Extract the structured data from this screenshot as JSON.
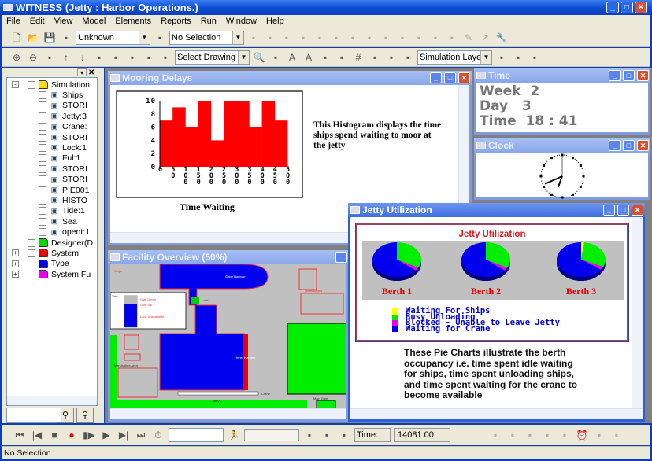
{
  "app": {
    "title": "WITNESS (Jetty : Harbor Operations.)"
  },
  "menu": [
    "File",
    "Edit",
    "View",
    "Model",
    "Elements",
    "Reports",
    "Run",
    "Window",
    "Help"
  ],
  "toolbar1": {
    "icons_left": [
      "new-icon",
      "open-icon",
      "save-icon"
    ],
    "type_combo": "Unknown",
    "selection_combo": "No Selection",
    "icons_right": [
      "walk-icon",
      "run-icon",
      "push-icon",
      "paint-icon",
      "flask-icon",
      "picture-icon",
      "link-icon",
      "move-icon",
      "gears-icon",
      "blob-icon",
      "image-icon",
      "camera-icon",
      "chart-icon",
      "pencil-icon",
      "arrow-icon",
      "wrench-icon"
    ]
  },
  "toolbar2": {
    "icons_left": [
      "zoom-in-icon",
      "zoom-out-icon",
      "fit-icon",
      "up-icon",
      "down-icon",
      "layer-icon",
      "align-icon",
      "distribute-icon",
      "list-icon",
      "drawing-icon"
    ],
    "drawing_combo": "Select Drawing",
    "icons_mid": [
      "search-icon",
      "image-icon",
      "font-icon",
      "font-color-icon",
      "line-color-icon",
      "fill-color-icon",
      "grid-icon",
      "grid-fine-icon",
      "grid-snap-icon",
      "frame-icon"
    ],
    "layer_combo": "Simulation Laye",
    "icons_right": [
      "window-icon",
      "window-front-icon",
      "layout-icon"
    ]
  },
  "tree": {
    "items": [
      {
        "label": "Simulation",
        "icon": "folder-icon",
        "color": "#ffe000",
        "level": 0,
        "expander": "-"
      },
      {
        "label": "Ships",
        "icon": "ship-icon",
        "level": 1
      },
      {
        "label": "STORI",
        "icon": "variable-icon",
        "level": 1
      },
      {
        "label": "Jetty:3",
        "icon": "machine-icon",
        "level": 1
      },
      {
        "label": "Crane:",
        "icon": "labor-icon",
        "level": 1
      },
      {
        "label": "STORI",
        "icon": "variable-icon",
        "level": 1
      },
      {
        "label": "Lock:1",
        "icon": "machine-icon",
        "level": 1
      },
      {
        "label": "Ful:1",
        "icon": "buffer-icon",
        "level": 1
      },
      {
        "label": "STORI",
        "icon": "variable-icon",
        "level": 1
      },
      {
        "label": "STORI",
        "icon": "variable-icon",
        "level": 1
      },
      {
        "label": "PIE001",
        "icon": "pie-icon",
        "level": 1
      },
      {
        "label": "HISTO",
        "icon": "histogram-icon",
        "level": 1
      },
      {
        "label": "Tide:1",
        "icon": "timeseries-icon",
        "level": 1
      },
      {
        "label": "Sea",
        "icon": "drop-icon",
        "level": 1
      },
      {
        "label": "opent:1",
        "icon": "counter-icon",
        "level": 1
      },
      {
        "label": "Designer(D",
        "icon": "folder-icon",
        "color": "#00dd00",
        "level": 0
      },
      {
        "label": "System",
        "icon": "folder-icon",
        "color": "#ee0000",
        "level": 0,
        "expander": "+"
      },
      {
        "label": "Type",
        "icon": "folder-icon",
        "color": "#0000ee",
        "level": 0,
        "expander": "+"
      },
      {
        "label": "System Fu",
        "icon": "folder-icon",
        "color": "#ee00ee",
        "level": 0,
        "expander": "+"
      }
    ]
  },
  "windows": {
    "mooring": {
      "title": "Mooring Delays",
      "description": "This Histogram displays the time ships spend waiting to moor at the jetty"
    },
    "time": {
      "title": "Time",
      "week_label": "Week",
      "week": "2",
      "day_label": "Day",
      "day": "3",
      "time_label": "Time",
      "time": "18 : 41"
    },
    "clock": {
      "title": "Clock",
      "hour": 18,
      "minute": 41
    },
    "facility": {
      "title": "Facility Overview (50%)",
      "labels": {
        "ships": "Ships",
        "outer": "Outer Harbour",
        "lock": "Lock",
        "tide": "Tide",
        "safe": "Safe Depth",
        "sill": "Over Sill",
        "lockun": "Lock Unavailable",
        "warehouses": "Warehouses",
        "marshalling": "Marshalling Area",
        "inner": "Inner Harbour",
        "jetty": "Jetty",
        "crane": "Crane",
        "gate": "Main Gate"
      }
    },
    "jetty": {
      "title": "Jetty Utilization",
      "description": "These Pie Charts illustrate the berth occupancy i.e. time spent idle waiting for ships, time spent unloading ships, and time spent waiting for the crane to become available"
    }
  },
  "chart_data": [
    {
      "type": "bar",
      "title": "",
      "xlabel": "Time Waiting",
      "ylabel": "",
      "categories": [
        "0",
        "50",
        "100",
        "150",
        "200",
        "250",
        "300",
        "350",
        "400",
        "450",
        "500"
      ],
      "bin_edges": [
        0,
        50,
        100,
        150,
        200,
        250,
        300,
        350,
        400,
        450,
        500
      ],
      "values": [
        7,
        9,
        6,
        10,
        4,
        10,
        10,
        6,
        10,
        7
      ],
      "ylim": [
        0,
        10
      ],
      "yticks": [
        "0",
        "2",
        "4",
        "6",
        "8",
        "10"
      ],
      "color": "#ff0000",
      "grid": false
    },
    {
      "type": "pie",
      "title": "Jetty Utilization",
      "legend_position": "bottom",
      "legend": [
        {
          "name": "Waiting For Ships",
          "color": "#ffff00"
        },
        {
          "name": "Busy Unloading",
          "color": "#00ee00"
        },
        {
          "name": "Blocked - Unable to Leave Jetty",
          "color": "#ee00ee"
        },
        {
          "name": "Waiting for Crane",
          "color": "#0000ee"
        }
      ],
      "pies": [
        {
          "label": "Berth 1",
          "values": [
            0,
            33,
            3,
            64
          ]
        },
        {
          "label": "Berth 2",
          "values": [
            0,
            33,
            3,
            64
          ]
        },
        {
          "label": "Berth 3",
          "values": [
            2,
            30,
            3,
            65
          ]
        }
      ]
    }
  ],
  "bottom_toolbar": {
    "icons_left": [
      "rewind-icon",
      "step-back-icon",
      "stop-icon",
      "record-icon",
      "step-icon",
      "play-icon",
      "step-end-icon",
      "fast-forward-icon",
      "timer-icon"
    ],
    "speed_icon": "runner-icon",
    "icons_mid": [
      "batch-icon",
      "breakpoint-icon",
      "window-icon"
    ],
    "time_label": "Time:",
    "time_value": "14081.00",
    "icons_right": [
      "report-icon",
      "notes-icon",
      "preview-icon",
      "flow-icon",
      "export-icon",
      "clock-icon",
      "stats-icon",
      "gauge-icon"
    ]
  },
  "status": {
    "text": "No Selection"
  }
}
